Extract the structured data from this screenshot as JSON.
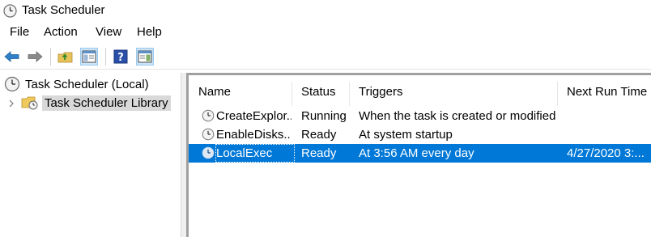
{
  "window": {
    "title": "Task Scheduler"
  },
  "menu": [
    {
      "label": "File"
    },
    {
      "label": "Action"
    },
    {
      "label": "View"
    },
    {
      "label": "Help"
    }
  ],
  "toolbar": {
    "buttons": [
      {
        "icon": "back-arrow-icon"
      },
      {
        "icon": "forward-arrow-icon"
      },
      {
        "icon": "folder-up-icon"
      },
      {
        "icon": "show-hide-console-tree-icon"
      },
      {
        "icon": "help-icon"
      },
      {
        "icon": "show-hide-action-pane-icon"
      }
    ]
  },
  "tree": {
    "root": "Task Scheduler (Local)",
    "library": "Task Scheduler Library"
  },
  "table": {
    "columns": [
      "Name",
      "Status",
      "Triggers",
      "Next Run Time"
    ],
    "rows": [
      {
        "name": "CreateExplor...",
        "status": "Running",
        "triggers": "When the task is created or modified",
        "next_run": ""
      },
      {
        "name": "EnableDisks...",
        "status": "Ready",
        "triggers": "At system startup",
        "next_run": ""
      },
      {
        "name": "LocalExec",
        "status": "Ready",
        "triggers": "At 3:56 AM every day",
        "next_run": "4/27/2020 3:..."
      }
    ],
    "selected_row": 2
  },
  "colors": {
    "selection": "#0078d7",
    "tree_selection": "#d9d9d9",
    "back_arrow": "#2f7fc9"
  }
}
